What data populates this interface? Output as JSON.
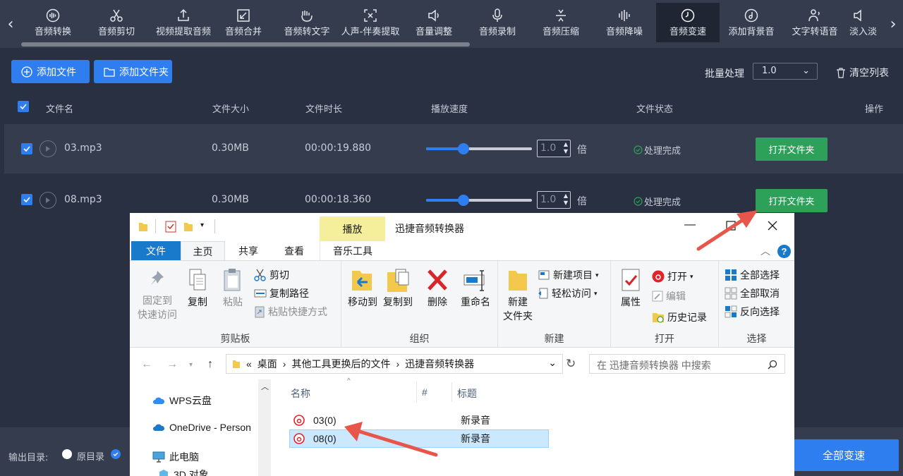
{
  "toolbar": {
    "tabs": [
      "音频转换",
      "音频剪切",
      "视频提取音频",
      "音频合并",
      "音频转文字",
      "人声-伴奏提取",
      "音量调整",
      "音频录制",
      "音频压缩",
      "音频降噪",
      "音频变速",
      "添加背景音",
      "文字转语音",
      "淡入淡"
    ],
    "active": "音频变速"
  },
  "actions": {
    "add_file": "添加文件",
    "add_folder": "添加文件夹",
    "batch_label": "批量处理",
    "batch_value": "1.0",
    "clear": "清空列表"
  },
  "table": {
    "headers": {
      "name": "文件名",
      "size": "文件大小",
      "duration": "文件时长",
      "speed": "播放速度",
      "status": "文件状态",
      "ops": "操作"
    },
    "rows": [
      {
        "name": "03.mp3",
        "size": "0.30MB",
        "duration": "00:00:19.880",
        "speed": "1.0",
        "speed_fraction": 0.35,
        "unit": "倍",
        "status": "处理完成",
        "button": "打开文件夹"
      },
      {
        "name": "08.mp3",
        "size": "0.30MB",
        "duration": "00:00:18.360",
        "speed": "1.0",
        "speed_fraction": 0.35,
        "unit": "倍",
        "status": "处理完成",
        "button": "打开文件夹"
      }
    ]
  },
  "bottom": {
    "output_label": "输出目录:",
    "original_dir": "原目录",
    "apply": "全部变速"
  },
  "explorer": {
    "title": "迅捷音频转换器",
    "context_tab": "播放",
    "context_sub": "音乐工具",
    "tabs": {
      "file": "文件",
      "home": "主页",
      "share": "共享",
      "view": "查看"
    },
    "ribbon": {
      "pin": "固定到\n快速访问",
      "copy": "复制",
      "paste": "粘贴",
      "cut": "剪切",
      "copy_path": "复制路径",
      "paste_shortcut": "粘贴快捷方式",
      "clipboard": "剪贴板",
      "move_to": "移动到",
      "copy_to": "复制到",
      "delete": "删除",
      "rename": "重命名",
      "organize": "组织",
      "new_folder": "新建\n文件夹",
      "new_item": "新建项目",
      "easy_access": "轻松访问",
      "new": "新建",
      "properties": "属性",
      "open": "打开",
      "edit": "编辑",
      "history": "历史记录",
      "open_group": "打开",
      "select_all": "全部选择",
      "select_none": "全部取消",
      "invert": "反向选择",
      "select": "选择"
    },
    "address": {
      "prefix": "«",
      "crumbs": [
        "桌面",
        "其他工具更换后的文件",
        "迅捷音频转换器"
      ]
    },
    "search_placeholder": "在 迅捷音频转换器 中搜索",
    "tree": [
      "WPS云盘",
      "OneDrive - Person",
      "此电脑",
      "3D 对象"
    ],
    "columns": {
      "name": "名称",
      "num": "#",
      "title": "标题"
    },
    "files": [
      {
        "name": "03(0)",
        "title": "新录音"
      },
      {
        "name": "08(0)",
        "title": "新录音"
      }
    ]
  },
  "colors": {
    "accent": "#2f7ef0",
    "green": "#2da15a",
    "arrow": "#e8554a"
  }
}
